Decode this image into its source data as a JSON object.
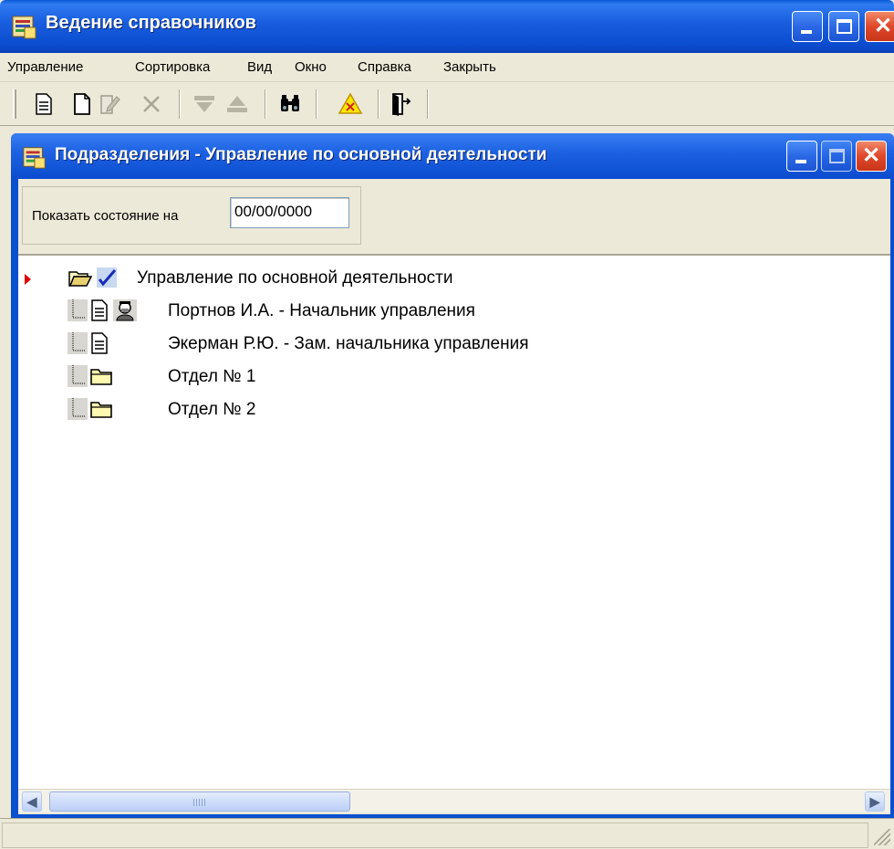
{
  "window": {
    "title": "Ведение справочников"
  },
  "menu": {
    "items": [
      "Управление",
      "Сортировка",
      "Вид",
      "Окно",
      "Справка",
      "Закрыть"
    ]
  },
  "toolbar": {
    "icons": [
      "properties-icon",
      "new-document-icon",
      "edit-document-icon",
      "delete-icon",
      "move-down-icon",
      "move-up-icon",
      "find-icon",
      "warning-icon",
      "exit-icon"
    ]
  },
  "child_window": {
    "title": "Подразделения - Управление по основной деятельности"
  },
  "state": {
    "label": "Показать состояние на",
    "date_value": "00/00/0000"
  },
  "tree": {
    "rows": [
      {
        "text": "Управление по основной деятельности",
        "icon": "open-folder-icon",
        "status_icon": "checkmark-icon"
      },
      {
        "text": "Портнов И.А. - Начальник управления",
        "icon": "document-icon",
        "status_icon": "manager-icon"
      },
      {
        "text": "Экерман Р.Ю. - Зам. начальника управления",
        "icon": "document-icon"
      },
      {
        "text": "Отдел № 1",
        "icon": "folder-icon"
      },
      {
        "text": "Отдел № 2",
        "icon": "folder-icon"
      }
    ]
  },
  "colors": {
    "title_bar": "#0b4ccf",
    "close_button": "#e0482a",
    "face": "#ece9d8",
    "row_marker": "#e00000"
  }
}
